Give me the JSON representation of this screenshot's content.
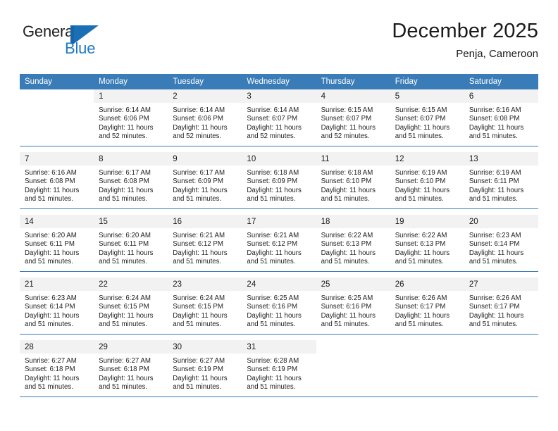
{
  "brand": {
    "name_part1": "General",
    "name_part2": "Blue",
    "mark": "blue-triangle-flag"
  },
  "header": {
    "title": "December 2025",
    "subtitle": "Penja, Cameroon"
  },
  "calendar": {
    "weekday_headers": [
      "Sunday",
      "Monday",
      "Tuesday",
      "Wednesday",
      "Thursday",
      "Friday",
      "Saturday"
    ],
    "accent_color": "#3a7cb8",
    "daynum_bg": "#f2f2f2",
    "weeks": [
      [
        {
          "day": "",
          "sunrise": "",
          "sunset": "",
          "daylight_line1": "",
          "daylight_line2": ""
        },
        {
          "day": "1",
          "sunrise": "Sunrise: 6:14 AM",
          "sunset": "Sunset: 6:06 PM",
          "daylight_line1": "Daylight: 11 hours",
          "daylight_line2": "and 52 minutes."
        },
        {
          "day": "2",
          "sunrise": "Sunrise: 6:14 AM",
          "sunset": "Sunset: 6:06 PM",
          "daylight_line1": "Daylight: 11 hours",
          "daylight_line2": "and 52 minutes."
        },
        {
          "day": "3",
          "sunrise": "Sunrise: 6:14 AM",
          "sunset": "Sunset: 6:07 PM",
          "daylight_line1": "Daylight: 11 hours",
          "daylight_line2": "and 52 minutes."
        },
        {
          "day": "4",
          "sunrise": "Sunrise: 6:15 AM",
          "sunset": "Sunset: 6:07 PM",
          "daylight_line1": "Daylight: 11 hours",
          "daylight_line2": "and 52 minutes."
        },
        {
          "day": "5",
          "sunrise": "Sunrise: 6:15 AM",
          "sunset": "Sunset: 6:07 PM",
          "daylight_line1": "Daylight: 11 hours",
          "daylight_line2": "and 51 minutes."
        },
        {
          "day": "6",
          "sunrise": "Sunrise: 6:16 AM",
          "sunset": "Sunset: 6:08 PM",
          "daylight_line1": "Daylight: 11 hours",
          "daylight_line2": "and 51 minutes."
        }
      ],
      [
        {
          "day": "7",
          "sunrise": "Sunrise: 6:16 AM",
          "sunset": "Sunset: 6:08 PM",
          "daylight_line1": "Daylight: 11 hours",
          "daylight_line2": "and 51 minutes."
        },
        {
          "day": "8",
          "sunrise": "Sunrise: 6:17 AM",
          "sunset": "Sunset: 6:08 PM",
          "daylight_line1": "Daylight: 11 hours",
          "daylight_line2": "and 51 minutes."
        },
        {
          "day": "9",
          "sunrise": "Sunrise: 6:17 AM",
          "sunset": "Sunset: 6:09 PM",
          "daylight_line1": "Daylight: 11 hours",
          "daylight_line2": "and 51 minutes."
        },
        {
          "day": "10",
          "sunrise": "Sunrise: 6:18 AM",
          "sunset": "Sunset: 6:09 PM",
          "daylight_line1": "Daylight: 11 hours",
          "daylight_line2": "and 51 minutes."
        },
        {
          "day": "11",
          "sunrise": "Sunrise: 6:18 AM",
          "sunset": "Sunset: 6:10 PM",
          "daylight_line1": "Daylight: 11 hours",
          "daylight_line2": "and 51 minutes."
        },
        {
          "day": "12",
          "sunrise": "Sunrise: 6:19 AM",
          "sunset": "Sunset: 6:10 PM",
          "daylight_line1": "Daylight: 11 hours",
          "daylight_line2": "and 51 minutes."
        },
        {
          "day": "13",
          "sunrise": "Sunrise: 6:19 AM",
          "sunset": "Sunset: 6:11 PM",
          "daylight_line1": "Daylight: 11 hours",
          "daylight_line2": "and 51 minutes."
        }
      ],
      [
        {
          "day": "14",
          "sunrise": "Sunrise: 6:20 AM",
          "sunset": "Sunset: 6:11 PM",
          "daylight_line1": "Daylight: 11 hours",
          "daylight_line2": "and 51 minutes."
        },
        {
          "day": "15",
          "sunrise": "Sunrise: 6:20 AM",
          "sunset": "Sunset: 6:11 PM",
          "daylight_line1": "Daylight: 11 hours",
          "daylight_line2": "and 51 minutes."
        },
        {
          "day": "16",
          "sunrise": "Sunrise: 6:21 AM",
          "sunset": "Sunset: 6:12 PM",
          "daylight_line1": "Daylight: 11 hours",
          "daylight_line2": "and 51 minutes."
        },
        {
          "day": "17",
          "sunrise": "Sunrise: 6:21 AM",
          "sunset": "Sunset: 6:12 PM",
          "daylight_line1": "Daylight: 11 hours",
          "daylight_line2": "and 51 minutes."
        },
        {
          "day": "18",
          "sunrise": "Sunrise: 6:22 AM",
          "sunset": "Sunset: 6:13 PM",
          "daylight_line1": "Daylight: 11 hours",
          "daylight_line2": "and 51 minutes."
        },
        {
          "day": "19",
          "sunrise": "Sunrise: 6:22 AM",
          "sunset": "Sunset: 6:13 PM",
          "daylight_line1": "Daylight: 11 hours",
          "daylight_line2": "and 51 minutes."
        },
        {
          "day": "20",
          "sunrise": "Sunrise: 6:23 AM",
          "sunset": "Sunset: 6:14 PM",
          "daylight_line1": "Daylight: 11 hours",
          "daylight_line2": "and 51 minutes."
        }
      ],
      [
        {
          "day": "21",
          "sunrise": "Sunrise: 6:23 AM",
          "sunset": "Sunset: 6:14 PM",
          "daylight_line1": "Daylight: 11 hours",
          "daylight_line2": "and 51 minutes."
        },
        {
          "day": "22",
          "sunrise": "Sunrise: 6:24 AM",
          "sunset": "Sunset: 6:15 PM",
          "daylight_line1": "Daylight: 11 hours",
          "daylight_line2": "and 51 minutes."
        },
        {
          "day": "23",
          "sunrise": "Sunrise: 6:24 AM",
          "sunset": "Sunset: 6:15 PM",
          "daylight_line1": "Daylight: 11 hours",
          "daylight_line2": "and 51 minutes."
        },
        {
          "day": "24",
          "sunrise": "Sunrise: 6:25 AM",
          "sunset": "Sunset: 6:16 PM",
          "daylight_line1": "Daylight: 11 hours",
          "daylight_line2": "and 51 minutes."
        },
        {
          "day": "25",
          "sunrise": "Sunrise: 6:25 AM",
          "sunset": "Sunset: 6:16 PM",
          "daylight_line1": "Daylight: 11 hours",
          "daylight_line2": "and 51 minutes."
        },
        {
          "day": "26",
          "sunrise": "Sunrise: 6:26 AM",
          "sunset": "Sunset: 6:17 PM",
          "daylight_line1": "Daylight: 11 hours",
          "daylight_line2": "and 51 minutes."
        },
        {
          "day": "27",
          "sunrise": "Sunrise: 6:26 AM",
          "sunset": "Sunset: 6:17 PM",
          "daylight_line1": "Daylight: 11 hours",
          "daylight_line2": "and 51 minutes."
        }
      ],
      [
        {
          "day": "28",
          "sunrise": "Sunrise: 6:27 AM",
          "sunset": "Sunset: 6:18 PM",
          "daylight_line1": "Daylight: 11 hours",
          "daylight_line2": "and 51 minutes."
        },
        {
          "day": "29",
          "sunrise": "Sunrise: 6:27 AM",
          "sunset": "Sunset: 6:18 PM",
          "daylight_line1": "Daylight: 11 hours",
          "daylight_line2": "and 51 minutes."
        },
        {
          "day": "30",
          "sunrise": "Sunrise: 6:27 AM",
          "sunset": "Sunset: 6:19 PM",
          "daylight_line1": "Daylight: 11 hours",
          "daylight_line2": "and 51 minutes."
        },
        {
          "day": "31",
          "sunrise": "Sunrise: 6:28 AM",
          "sunset": "Sunset: 6:19 PM",
          "daylight_line1": "Daylight: 11 hours",
          "daylight_line2": "and 51 minutes."
        },
        {
          "day": "",
          "sunrise": "",
          "sunset": "",
          "daylight_line1": "",
          "daylight_line2": ""
        },
        {
          "day": "",
          "sunrise": "",
          "sunset": "",
          "daylight_line1": "",
          "daylight_line2": ""
        },
        {
          "day": "",
          "sunrise": "",
          "sunset": "",
          "daylight_line1": "",
          "daylight_line2": ""
        }
      ]
    ]
  }
}
